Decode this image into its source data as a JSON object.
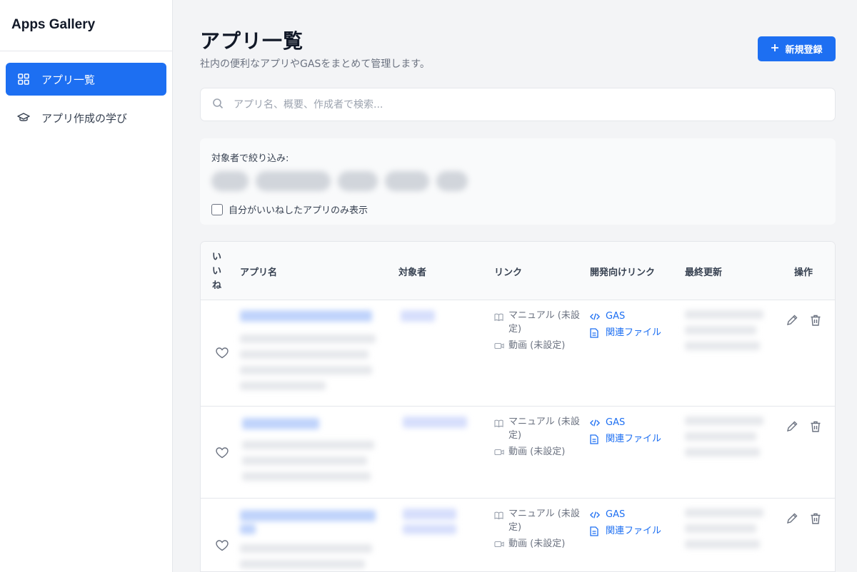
{
  "app": {
    "brand": "Apps Gallery"
  },
  "sidebar": {
    "items": [
      {
        "label": "アプリ一覧",
        "icon": "grid-icon",
        "active": true
      },
      {
        "label": "アプリ作成の学び",
        "icon": "graduation-cap-icon",
        "active": false
      }
    ]
  },
  "page": {
    "title": "アプリ一覧",
    "subtitle": "社内の便利なアプリやGASをまとめて管理します。",
    "new_button": "新規登録"
  },
  "search": {
    "placeholder": "アプリ名、概要、作成者で検索..."
  },
  "filter": {
    "label": "対象者で絞り込み:",
    "liked_only_label": "自分がいいねしたアプリのみ表示",
    "liked_only_checked": false
  },
  "table": {
    "headers": {
      "like": "いいね",
      "name": "アプリ名",
      "audience": "対象者",
      "links": "リンク",
      "dev_links": "開発向けリンク",
      "updated": "最終更新",
      "actions": "操作"
    },
    "rows": [
      {
        "manual": "マニュアル (未設定)",
        "video": "動画 (未設定)",
        "gas": "GAS",
        "files": "関連ファイル"
      },
      {
        "manual": "マニュアル (未設定)",
        "video": "動画 (未設定)",
        "gas": "GAS",
        "files": "関連ファイル"
      },
      {
        "manual": "マニュアル (未設定)",
        "video": "動画 (未設定)",
        "gas": "GAS",
        "files": "関連ファイル"
      }
    ]
  },
  "colors": {
    "accent": "#1d6ff2",
    "background": "#f3f4f6"
  }
}
